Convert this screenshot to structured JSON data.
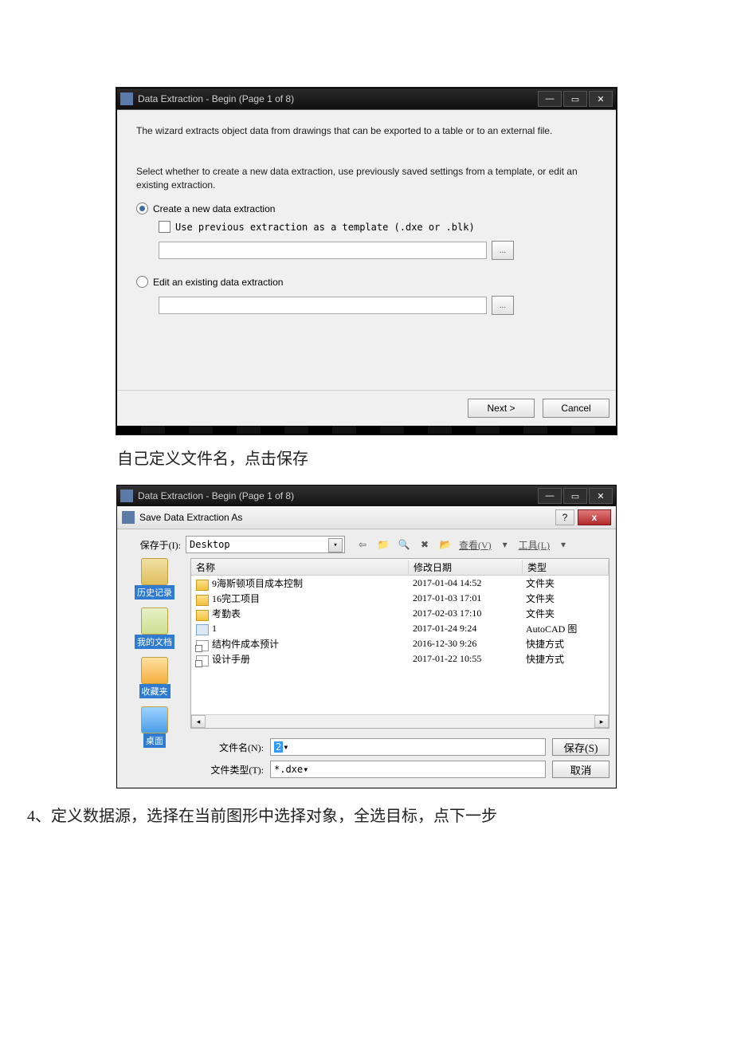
{
  "dialog1": {
    "title": "Data Extraction - Begin (Page 1 of 8)",
    "intro": "The wizard extracts object data from drawings that can be exported to a table or to an external file.",
    "prompt": "Select whether to create a new data extraction, use previously saved settings from a template, or edit an existing extraction.",
    "opt_create": "Create a new data extraction",
    "opt_template": "Use previous extraction as a template (.dxe or .blk)",
    "opt_edit": "Edit an existing data extraction",
    "browse": "...",
    "next": "Next >",
    "cancel": "Cancel"
  },
  "text1": "自己定义文件名，点击保存",
  "dialog2": {
    "title": "Data Extraction - Begin (Page 1 of 8)",
    "modal_title": "Save Data Extraction As",
    "save_in_label": "保存于(I):",
    "save_in_value": "Desktop",
    "view_label": "查看(V)",
    "tools_label": "工具(L)",
    "cols": {
      "name": "名称",
      "date": "修改日期",
      "type": "类型"
    },
    "rows": [
      {
        "icon": "folder",
        "name": "9海斯顿项目成本控制",
        "date": "2017-01-04 14:52",
        "type": "文件夹"
      },
      {
        "icon": "folder",
        "name": "16完工项目",
        "date": "2017-01-03 17:01",
        "type": "文件夹"
      },
      {
        "icon": "folder",
        "name": "考勤表",
        "date": "2017-02-03 17:10",
        "type": "文件夹"
      },
      {
        "icon": "dwg",
        "name": "1",
        "date": "2017-01-24 9:24",
        "type": "AutoCAD 图"
      },
      {
        "icon": "lnk",
        "name": "结构件成本预计",
        "date": "2016-12-30 9:26",
        "type": "快捷方式"
      },
      {
        "icon": "lnk",
        "name": "设计手册",
        "date": "2017-01-22 10:55",
        "type": "快捷方式"
      }
    ],
    "sidebar": {
      "history": "历史记录",
      "mydocs": "我的文档",
      "fav": "收藏夹",
      "desktop": "桌面"
    },
    "filename_label": "文件名(N):",
    "filename_value": "2",
    "filetype_label": "文件类型(T):",
    "filetype_value": "*.dxe",
    "save_btn": "保存(S)",
    "cancel_btn": "取消"
  },
  "text2": "4、定义数据源，选择在当前图形中选择对象，全选目标，点下一步"
}
